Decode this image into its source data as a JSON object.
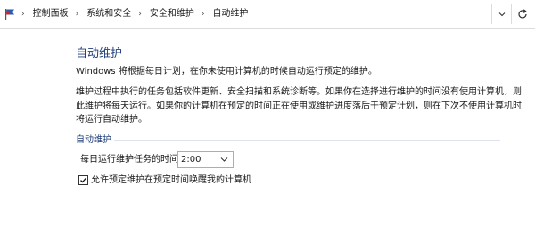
{
  "address_bar": {
    "breadcrumbs": [
      "控制面板",
      "系统和安全",
      "安全和维护",
      "自动维护"
    ]
  },
  "content": {
    "title": "自动维护",
    "intro": "Windows 将根据每日计划，在你未使用计算机的时候自动运行预定的维护。",
    "description": "维护过程中执行的任务包括软件更新、安全扫描和系统诊断等。如果你在选择进行维护的时间没有使用计算机，则此维护将每天运行。如果你的计算机在预定的时间正在使用或维护进度落后于预定计划，则在下次不使用计算机时将运行自动维护。",
    "section_title": "自动维护",
    "daily_time_label": "每日运行维护任务的时间",
    "daily_time_value": "2:00",
    "wake_checkbox_label": "允许预定维护在预定时间唤醒我的计算机",
    "wake_checkbox_checked": true
  },
  "colors": {
    "heading": "#1f3d7a",
    "flag_blue": "#2a5db0",
    "flag_red": "#c4262e"
  },
  "icons": {
    "location": "control-panel-flag-icon",
    "dropdown": "chevron-down-icon",
    "refresh": "refresh-icon"
  }
}
